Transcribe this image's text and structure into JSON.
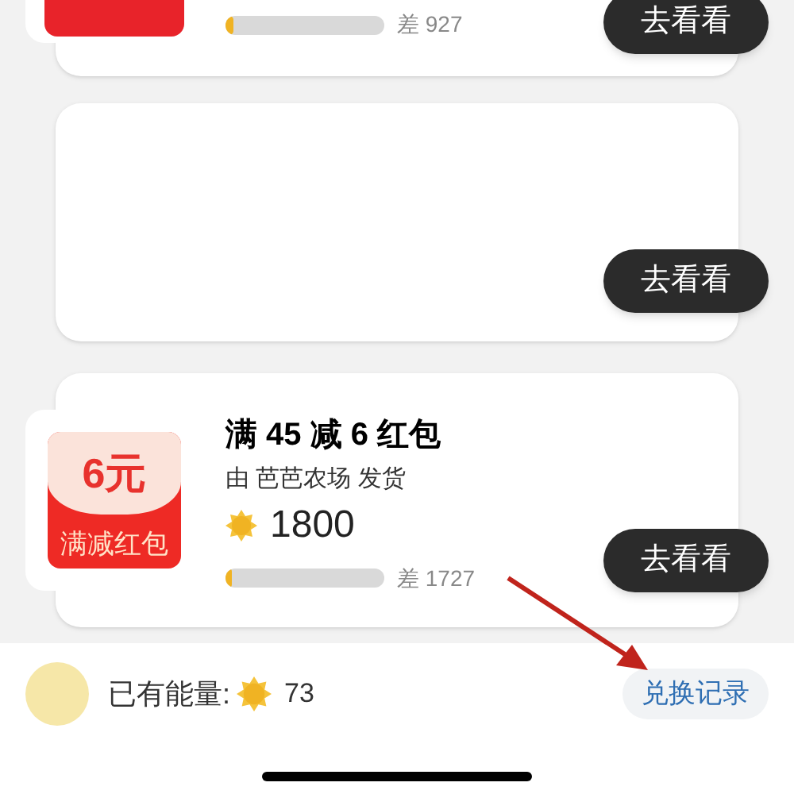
{
  "cards": [
    {
      "kind": "partial",
      "progress": {
        "level": 0.05,
        "reading": "差 927"
      },
      "button": "去看看"
    },
    {
      "kind": "empty",
      "button": "去看看"
    },
    {
      "kind": "full",
      "badge": {
        "amount": "6元",
        "label": "满减红包"
      },
      "title": "满 45 减 6 红包",
      "subtitle": "由 芭芭农场 发货",
      "price": "1800",
      "progress": {
        "level": 0.03,
        "reading": "差 1727"
      },
      "button": "去看看"
    }
  ],
  "footer": {
    "label": "已有能量:",
    "energy": "73",
    "link": "兑换记录"
  }
}
